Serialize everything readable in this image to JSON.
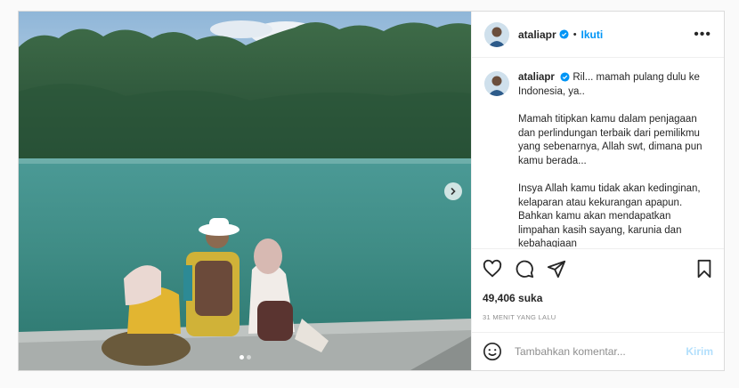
{
  "post": {
    "username": "ataliapr",
    "follow_label": "Ikuti",
    "separator": "•",
    "more_label": "•••",
    "caption_paragraphs": [
      "Ril... mamah pulang dulu ke Indonesia, ya..",
      "Mamah titipkan kamu dalam penjagaan dan perlindungan terbaik dari pemilikmu yang sebenarnya, Allah swt, dimana pun kamu berada...",
      "Insya Allah kamu tidak akan kedinginan, kelaparan atau kekurangan apapun. Bahkan kamu akan mendapatkan limpahan kasih sayang, karunia dan kebahagiaan"
    ],
    "likes": "49,406 suka",
    "time_ago": "31 MENIT YANG LALU",
    "comment_placeholder": "Tambahkan komentar...",
    "post_label": "Kirim",
    "carousel_count": 2,
    "carousel_active": 1
  },
  "icons": {
    "verified": "verified-badge-icon",
    "like": "heart-icon",
    "comment": "comment-icon",
    "share": "share-icon",
    "save": "bookmark-icon",
    "emoji": "emoji-icon",
    "next": "chevron-right-icon"
  },
  "colors": {
    "accent": "#0095f6",
    "post_disabled": "#b2dffc",
    "lake": "#3f8c85",
    "forest": "#2f5a3e"
  }
}
